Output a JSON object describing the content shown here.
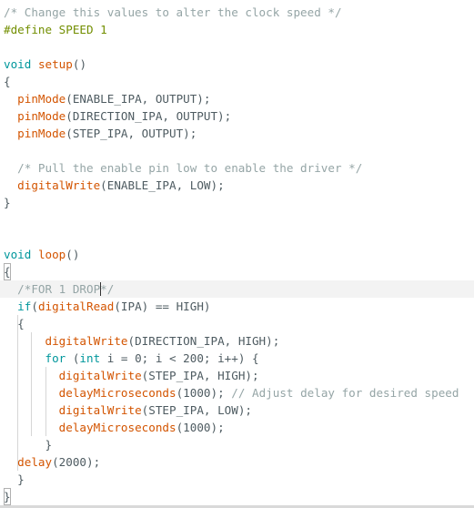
{
  "editor": {
    "current_line": 17,
    "lines": [
      [
        {
          "t": "/* Change this values to alter the clock speed */",
          "c": "cm"
        }
      ],
      [
        {
          "t": "#define SPEED 1",
          "c": "pp"
        }
      ],
      [],
      [
        {
          "t": "void",
          "c": "kw"
        },
        {
          "t": " ",
          "c": "pl"
        },
        {
          "t": "setup",
          "c": "fn"
        },
        {
          "t": "()",
          "c": "pl"
        }
      ],
      [
        {
          "t": "{",
          "c": "pl"
        }
      ],
      [
        {
          "t": "  ",
          "c": "pl"
        },
        {
          "t": "pinMode",
          "c": "fn"
        },
        {
          "t": "(ENABLE_IPA, OUTPUT);",
          "c": "pl"
        }
      ],
      [
        {
          "t": "  ",
          "c": "pl"
        },
        {
          "t": "pinMode",
          "c": "fn"
        },
        {
          "t": "(DIRECTION_IPA, OUTPUT);",
          "c": "pl"
        }
      ],
      [
        {
          "t": "  ",
          "c": "pl"
        },
        {
          "t": "pinMode",
          "c": "fn"
        },
        {
          "t": "(STEP_IPA, OUTPUT);",
          "c": "pl"
        }
      ],
      [],
      [
        {
          "t": "  ",
          "c": "pl"
        },
        {
          "t": "/* Pull the enable pin low to enable the driver */",
          "c": "cm"
        }
      ],
      [
        {
          "t": "  ",
          "c": "pl"
        },
        {
          "t": "digitalWrite",
          "c": "fn"
        },
        {
          "t": "(ENABLE_IPA, LOW);",
          "c": "pl"
        }
      ],
      [
        {
          "t": "}",
          "c": "pl"
        }
      ],
      [],
      [],
      [
        {
          "t": "void",
          "c": "kw"
        },
        {
          "t": " ",
          "c": "pl"
        },
        {
          "t": "loop",
          "c": "fn"
        },
        {
          "t": "()",
          "c": "pl"
        }
      ],
      [
        {
          "t": "{",
          "c": "pl",
          "bm": true
        }
      ],
      [
        {
          "t": "  ",
          "c": "pl"
        },
        {
          "t": "/*FOR 1 DROP",
          "c": "cm"
        },
        {
          "caret": true
        },
        {
          "t": "*/",
          "c": "cm"
        }
      ],
      [
        {
          "t": "  ",
          "c": "pl"
        },
        {
          "t": "if",
          "c": "kw"
        },
        {
          "t": "(",
          "c": "pl"
        },
        {
          "t": "digitalRead",
          "c": "fn"
        },
        {
          "t": "(IPA) == HIGH)",
          "c": "pl"
        }
      ],
      [
        {
          "t": "  {",
          "c": "pl"
        }
      ],
      [
        {
          "t": "      ",
          "c": "pl"
        },
        {
          "t": "digitalWrite",
          "c": "fn"
        },
        {
          "t": "(DIRECTION_IPA, HIGH);",
          "c": "pl"
        }
      ],
      [
        {
          "t": "      ",
          "c": "pl"
        },
        {
          "t": "for",
          "c": "kw"
        },
        {
          "t": " (",
          "c": "pl"
        },
        {
          "t": "int",
          "c": "kw"
        },
        {
          "t": " i = 0; i < 200; i++) {",
          "c": "pl"
        }
      ],
      [
        {
          "t": "        ",
          "c": "pl"
        },
        {
          "t": "digitalWrite",
          "c": "fn"
        },
        {
          "t": "(STEP_IPA, HIGH);",
          "c": "pl"
        }
      ],
      [
        {
          "t": "        ",
          "c": "pl"
        },
        {
          "t": "delayMicroseconds",
          "c": "fn"
        },
        {
          "t": "(1000); ",
          "c": "pl"
        },
        {
          "t": "// Adjust delay for desired speed",
          "c": "cm"
        }
      ],
      [
        {
          "t": "        ",
          "c": "pl"
        },
        {
          "t": "digitalWrite",
          "c": "fn"
        },
        {
          "t": "(STEP_IPA, LOW);",
          "c": "pl"
        }
      ],
      [
        {
          "t": "        ",
          "c": "pl"
        },
        {
          "t": "delayMicroseconds",
          "c": "fn"
        },
        {
          "t": "(1000);",
          "c": "pl"
        }
      ],
      [
        {
          "t": "      }",
          "c": "pl"
        }
      ],
      [
        {
          "t": "  ",
          "c": "pl"
        },
        {
          "t": "delay",
          "c": "fn"
        },
        {
          "t": "(2000);",
          "c": "pl"
        }
      ],
      [
        {
          "t": "  }",
          "c": "pl"
        }
      ],
      [
        {
          "t": "}",
          "c": "pl",
          "bm": true
        }
      ]
    ]
  }
}
